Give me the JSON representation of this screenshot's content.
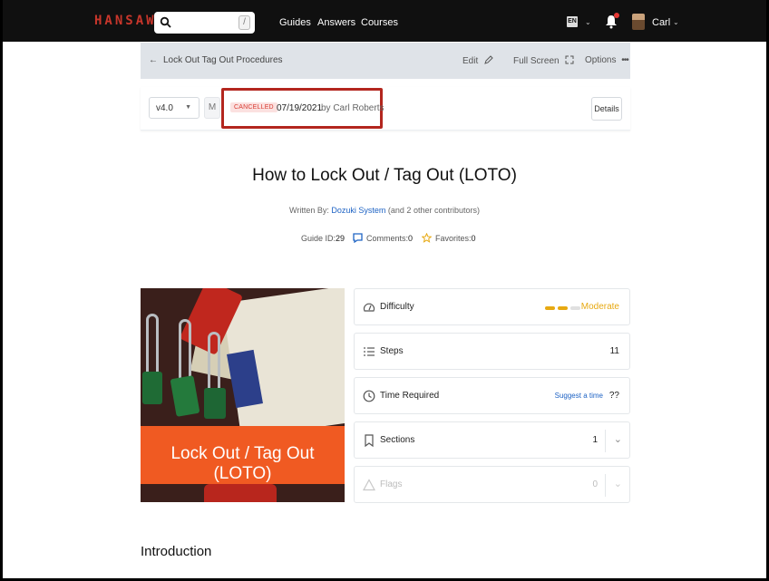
{
  "header": {
    "logo": "HANSAW",
    "search_placeholder": "",
    "search_shortcut": "/",
    "nav": [
      "Guides",
      "Answers",
      "Courses"
    ],
    "language": "EN",
    "user": "Carl"
  },
  "breadcrumb": {
    "back_label": "Lock Out Tag Out Procedures",
    "actions": {
      "edit": "Edit",
      "fullscreen": "Full Screen",
      "options": "Options"
    }
  },
  "version_bar": {
    "version": "v4.0",
    "m_label": "M",
    "status_badge": "CANCELLED",
    "date": "07/19/2021",
    "by": "by Carl Roberts",
    "details_button": "Details",
    "colors": {
      "highlight": "#b3261e",
      "badge_bg": "#fbe1e0",
      "badge_text": "#d83b32"
    }
  },
  "guide": {
    "title": "How to Lock Out / Tag Out (LOTO)",
    "written_by_label": "Written By:",
    "author": "Dozuki System",
    "contributors": "(and 2 other contributors)",
    "guide_id_label": "Guide ID:",
    "guide_id": "29",
    "comments_label": "Comments:",
    "comments": "0",
    "favorites_label": "Favorites:",
    "favorites": "0",
    "hero_banner": "Lock Out / Tag Out (LOTO)"
  },
  "details": {
    "difficulty_label": "Difficulty",
    "difficulty_value": "Moderate",
    "difficulty_level": 2,
    "difficulty_max": 3,
    "steps_label": "Steps",
    "steps_value": "11",
    "time_label": "Time Required",
    "time_suggest": "Suggest a time",
    "time_value": "??",
    "sections_label": "Sections",
    "sections_value": "1",
    "flags_label": "Flags",
    "flags_value": "0",
    "accent_color": "#e7a912",
    "link_color": "#1e63c4"
  },
  "section_heading": "Introduction"
}
